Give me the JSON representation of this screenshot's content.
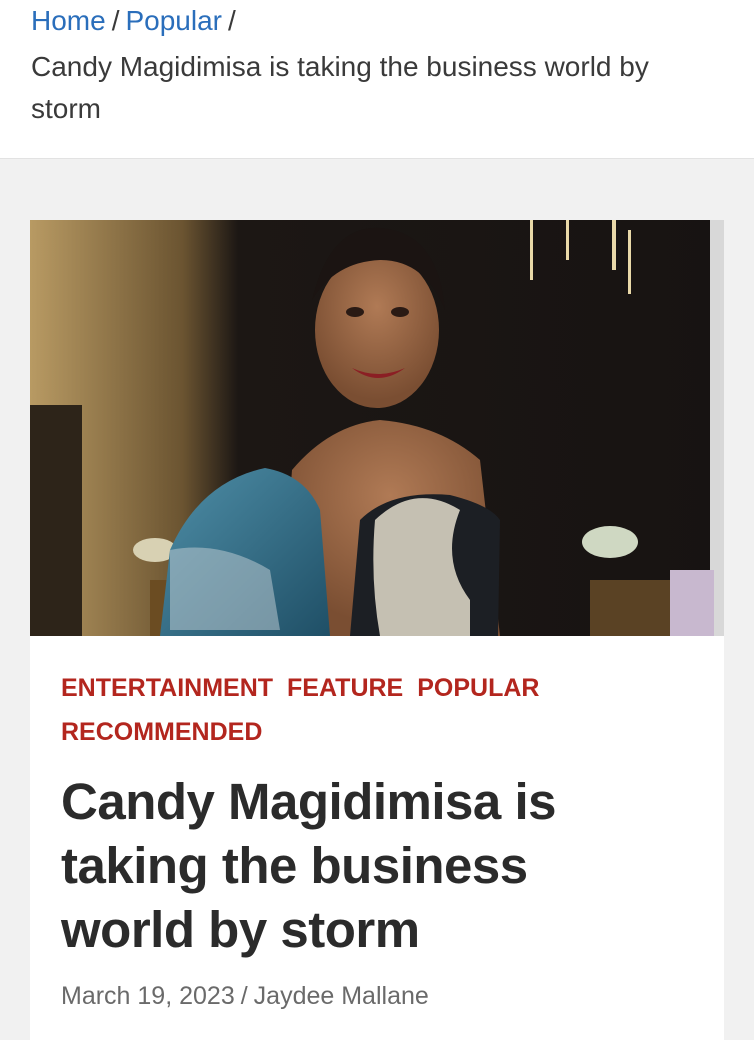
{
  "breadcrumb": {
    "items": [
      "Home",
      "Popular"
    ],
    "separator": "/",
    "current": "Candy Magidimisa is taking the business world by storm"
  },
  "article": {
    "categories": [
      "ENTERTAINMENT",
      "FEATURE",
      "POPULAR",
      "RECOMMENDED"
    ],
    "title": "Candy Magidimisa is taking the business world by storm",
    "date": "March 19, 2023",
    "meta_separator": "/",
    "author": "Jaydee Mallane"
  },
  "colors": {
    "link": "#2a6ebb",
    "category": "#b3261e",
    "title": "#2b2b2b",
    "meta": "#6a6a6a"
  },
  "icons": [
    "hero-photo"
  ]
}
